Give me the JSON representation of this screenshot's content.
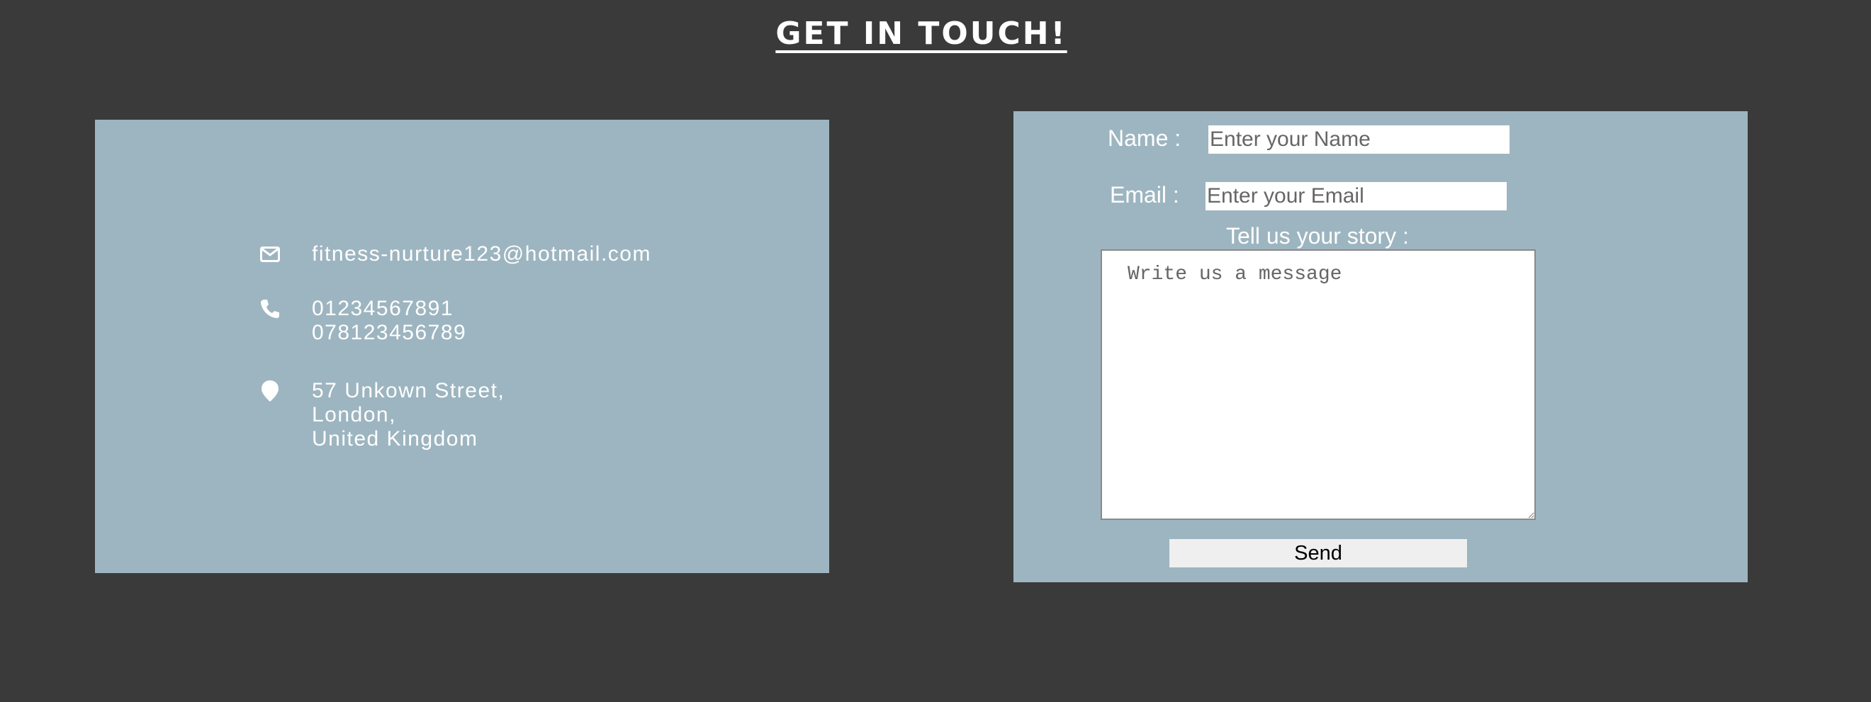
{
  "header": {
    "title": "GET IN TOUCH!"
  },
  "contact": {
    "email": "fitness-nurture123@hotmail.com",
    "phone_1": "01234567891",
    "phone_2": "078123456789",
    "address_line_1": "57 Unkown Street,",
    "address_line_2": "London,",
    "address_line_3": "United Kingdom",
    "icons": [
      "envelope-icon",
      "phone-icon",
      "map-marker-icon"
    ]
  },
  "form": {
    "name_label": "Name :",
    "name_placeholder": "Enter your Name",
    "email_label": "Email :",
    "email_placeholder": "Enter your Email",
    "story_label": "Tell us your story :",
    "message_placeholder": "Write us a message",
    "send_label": "Send"
  },
  "colors": {
    "background": "#3a3a3a",
    "card": "#9db5c0",
    "text": "#ffffff",
    "button": "#efefef"
  }
}
